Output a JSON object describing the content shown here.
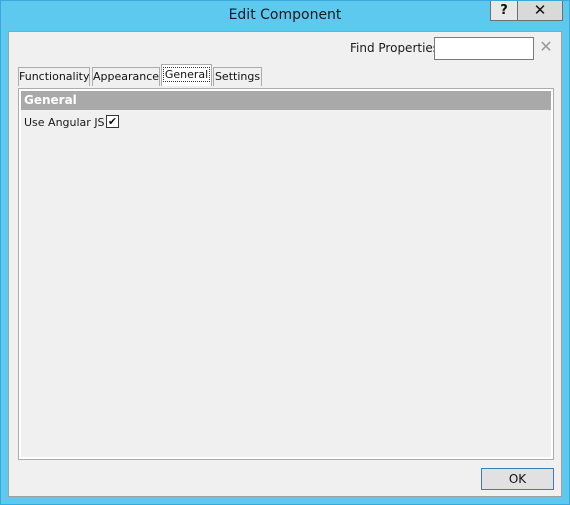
{
  "window": {
    "title": "Edit Component",
    "help_label": "?",
    "close_label": "✕"
  },
  "find": {
    "label": "Find Properties",
    "value": "",
    "clear_label": "✕"
  },
  "tabs": [
    {
      "label": "Functionality",
      "active": false
    },
    {
      "label": "Appearance",
      "active": false
    },
    {
      "label": "General",
      "active": true
    },
    {
      "label": "Settings",
      "active": false
    }
  ],
  "panel": {
    "group_header": "General",
    "properties": [
      {
        "label": "Use Angular JS",
        "checked": true,
        "check_glyph": "✔"
      }
    ]
  },
  "footer": {
    "ok_label": "OK"
  }
}
